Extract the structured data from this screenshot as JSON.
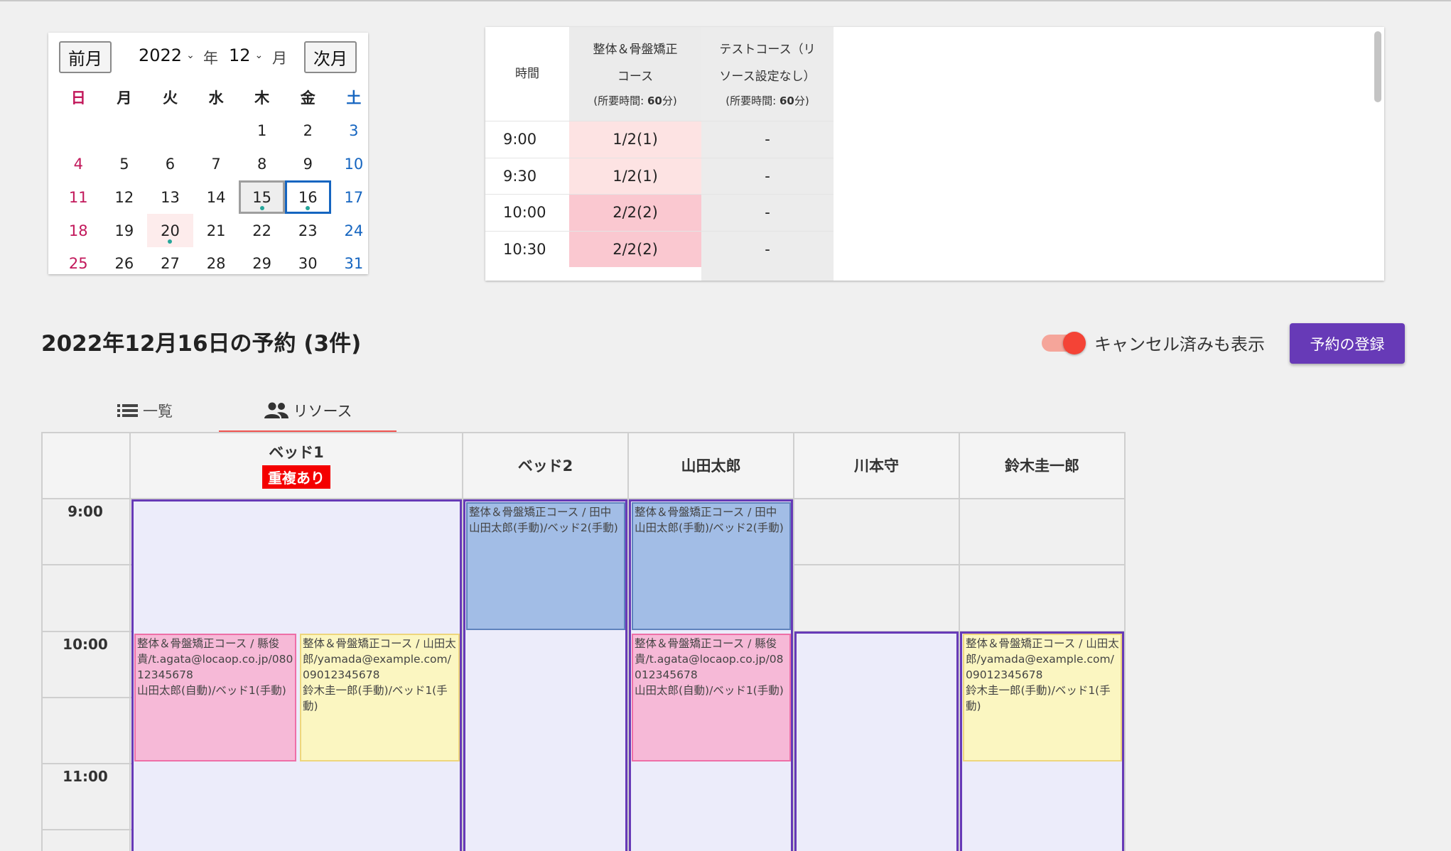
{
  "calendar": {
    "prev_label": "前月",
    "next_label": "次月",
    "year": "2022",
    "year_unit": "年",
    "month": "12",
    "month_unit": "月",
    "weekdays": [
      "日",
      "月",
      "火",
      "水",
      "木",
      "金",
      "土"
    ],
    "weeks": [
      [
        "",
        "",
        "",
        "",
        "1",
        "2",
        "3"
      ],
      [
        "4",
        "5",
        "6",
        "7",
        "8",
        "9",
        "10"
      ],
      [
        "11",
        "12",
        "13",
        "14",
        "15",
        "16",
        "17"
      ],
      [
        "18",
        "19",
        "20",
        "21",
        "22",
        "23",
        "24"
      ],
      [
        "25",
        "26",
        "27",
        "28",
        "29",
        "30",
        "31"
      ]
    ],
    "today": "15",
    "selected": "16",
    "holiday": "20",
    "dot_days": [
      "15",
      "16",
      "20"
    ]
  },
  "availability": {
    "time_header": "時間",
    "courses": [
      {
        "name_line1": "整体＆骨盤矯正",
        "name_line2": "コース",
        "duration_prefix": "(所要時間: ",
        "duration_value": "60",
        "duration_suffix": "分)"
      },
      {
        "name_line1": "テストコース（リ",
        "name_line2": "ソース設定なし）",
        "duration_prefix": "(所要時間: ",
        "duration_value": "60",
        "duration_suffix": "分)"
      }
    ],
    "rows": [
      {
        "time": "9:00",
        "c1": "1/2(1)",
        "c2": "-"
      },
      {
        "time": "9:30",
        "c1": "1/2(1)",
        "c2": "-"
      },
      {
        "time": "10:00",
        "c1": "2/2(2)",
        "c2": "-"
      },
      {
        "time": "10:30",
        "c1": "2/2(2)",
        "c2": "-"
      }
    ],
    "colors": {
      "light": "#fde3e3",
      "strong": "#fac8d0",
      "grey_col": "#ececec"
    }
  },
  "heading": "2022年12月16日の予約 (3件)",
  "toggle": {
    "label": "キャンセル済みも表示",
    "on": true
  },
  "register_button": "予約の登録",
  "tabs": [
    {
      "label": "一覧",
      "icon": "list-icon"
    },
    {
      "label": "リソース",
      "icon": "people-icon",
      "active": true
    }
  ],
  "resources": [
    {
      "name": "ベッド1",
      "badge": "重複あり"
    },
    {
      "name": "ベッド2"
    },
    {
      "name": "山田太郎"
    },
    {
      "name": "川本守"
    },
    {
      "name": "鈴木圭一郎"
    }
  ],
  "time_labels": [
    "9:00",
    "10:00",
    "11:00"
  ],
  "appointments": {
    "tanaka": {
      "line1": "整体＆骨盤矯正コース / 田中",
      "line2": "山田太郎(手動)/ベッド2(手動)"
    },
    "agata": {
      "line1": "整体＆骨盤矯正コース / 縣俊貴/t.agata@locaop.co.jp/08012345678",
      "line2": "山田太郎(自動)/ベッド1(手動)"
    },
    "yamada": {
      "line1": "整体＆骨盤矯正コース / 山田太郎/yamada@example.com/09012345678",
      "line2": "鈴木圭一郎(手動)/ベッド1(手動)"
    }
  }
}
